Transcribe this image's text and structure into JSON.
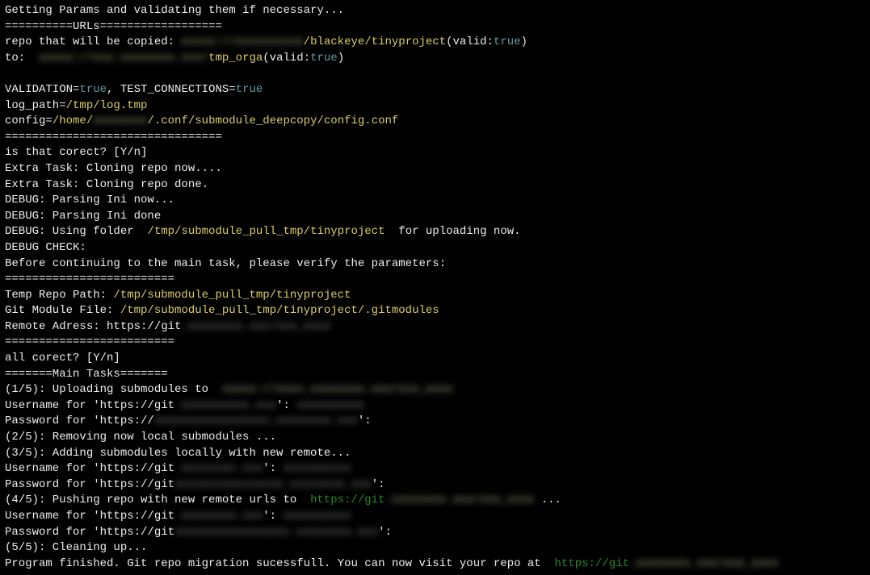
{
  "lines": [
    {
      "segments": [
        {
          "text": "Getting Params and validating them if necessary...",
          "cls": "c-white"
        }
      ]
    },
    {
      "segments": [
        {
          "text": "==========URLs==================",
          "cls": "c-white"
        }
      ]
    },
    {
      "segments": [
        {
          "text": "repo that will be copied: ",
          "cls": "c-white"
        },
        {
          "text": "xxxxx://xxxxxxxxxx",
          "cls": "blur"
        },
        {
          "text": "/blackeye/tinyproject",
          "cls": "c-yellow"
        },
        {
          "text": "(valid:",
          "cls": "c-white"
        },
        {
          "text": "true",
          "cls": "c-teal"
        },
        {
          "text": ")",
          "cls": "c-white"
        }
      ]
    },
    {
      "segments": [
        {
          "text": "to:  ",
          "cls": "c-white"
        },
        {
          "text": "xxxxx://xxx.xxxxxxxx.xxx/",
          "cls": "blur"
        },
        {
          "text": "tmp_orga",
          "cls": "c-yellow"
        },
        {
          "text": "(valid:",
          "cls": "c-white"
        },
        {
          "text": "true",
          "cls": "c-teal"
        },
        {
          "text": ")",
          "cls": "c-white"
        }
      ]
    },
    {
      "segments": [
        {
          "text": " ",
          "cls": "c-white"
        }
      ]
    },
    {
      "segments": [
        {
          "text": "VALIDATION=",
          "cls": "c-white"
        },
        {
          "text": "true",
          "cls": "c-teal"
        },
        {
          "text": ", TEST_CONNECTIONS=",
          "cls": "c-white"
        },
        {
          "text": "true",
          "cls": "c-teal"
        }
      ]
    },
    {
      "segments": [
        {
          "text": "log_path=",
          "cls": "c-white"
        },
        {
          "text": "/tmp/log.tmp",
          "cls": "c-yellow"
        }
      ]
    },
    {
      "segments": [
        {
          "text": "config=",
          "cls": "c-white"
        },
        {
          "text": "/home/",
          "cls": "c-yellow"
        },
        {
          "text": "xxxxxxxx",
          "cls": "blur"
        },
        {
          "text": "/.conf/submodule_deepcopy/config.conf",
          "cls": "c-yellow"
        }
      ]
    },
    {
      "segments": [
        {
          "text": "================================",
          "cls": "c-white"
        }
      ]
    },
    {
      "segments": [
        {
          "text": "is that corect? [Y/n]",
          "cls": "c-white"
        }
      ]
    },
    {
      "segments": [
        {
          "text": "Extra Task: Cloning repo now....",
          "cls": "c-white"
        }
      ]
    },
    {
      "segments": [
        {
          "text": "Extra Task: Cloning repo done.",
          "cls": "c-white"
        }
      ]
    },
    {
      "segments": [
        {
          "text": "DEBUG: Parsing Ini now...",
          "cls": "c-white"
        }
      ]
    },
    {
      "segments": [
        {
          "text": "DEBUG: Parsing Ini done",
          "cls": "c-white"
        }
      ]
    },
    {
      "segments": [
        {
          "text": "DEBUG: Using folder  ",
          "cls": "c-white"
        },
        {
          "text": "/tmp/submodule_pull_tmp/tinyproject",
          "cls": "c-yellow"
        },
        {
          "text": "  for uploading now.",
          "cls": "c-white"
        }
      ]
    },
    {
      "segments": [
        {
          "text": "DEBUG CHECK:",
          "cls": "c-white"
        }
      ]
    },
    {
      "segments": [
        {
          "text": "Before continuing to the main task, please verify the parameters:",
          "cls": "c-white"
        }
      ]
    },
    {
      "segments": [
        {
          "text": "=========================",
          "cls": "c-white"
        }
      ]
    },
    {
      "segments": [
        {
          "text": "Temp Repo Path: ",
          "cls": "c-white"
        },
        {
          "text": "/tmp/submodule_pull_tmp/tinyproject",
          "cls": "c-yellow"
        }
      ]
    },
    {
      "segments": [
        {
          "text": "Git Module File: ",
          "cls": "c-white"
        },
        {
          "text": "/tmp/submodule_pull_tmp/tinyproject/.gitmodules",
          "cls": "c-yellow"
        }
      ]
    },
    {
      "segments": [
        {
          "text": "Remote Adress: https://git",
          "cls": "c-white"
        },
        {
          "text": ".xxxxxxxx.xxx/xxx_xxxx",
          "cls": "blur-dim"
        }
      ]
    },
    {
      "segments": [
        {
          "text": "=========================",
          "cls": "c-white"
        }
      ]
    },
    {
      "segments": [
        {
          "text": "all corect? [Y/n]",
          "cls": "c-white"
        }
      ]
    },
    {
      "segments": [
        {
          "text": "=======Main Tasks=======",
          "cls": "c-white"
        }
      ]
    },
    {
      "segments": [
        {
          "text": "(1/5): Uploading submodules to  ",
          "cls": "c-white"
        },
        {
          "text": "xxxxx://xxxx.xxxxxxxx.xxx/xxx_xxxx",
          "cls": "blur"
        }
      ]
    },
    {
      "segments": [
        {
          "text": "Username for 'https://git",
          "cls": "c-white"
        },
        {
          "text": ".xxxxxxxxxx.xxx",
          "cls": "blur-dim"
        },
        {
          "text": "': ",
          "cls": "c-white"
        },
        {
          "text": "xxxxxxxxxx",
          "cls": "blur-dim"
        }
      ]
    },
    {
      "segments": [
        {
          "text": "Password for 'https://",
          "cls": "c-white"
        },
        {
          "text": "xxxxxxxxxxxxxxxxx.xxxxxxxx.xxx",
          "cls": "blur-dim"
        },
        {
          "text": "':",
          "cls": "c-white"
        }
      ]
    },
    {
      "segments": [
        {
          "text": "(2/5): Removing now local submodules ...",
          "cls": "c-white"
        }
      ]
    },
    {
      "segments": [
        {
          "text": "(3/5): Adding submodules locally with new remote...",
          "cls": "c-white"
        }
      ]
    },
    {
      "segments": [
        {
          "text": "Username for 'https://git",
          "cls": "c-white"
        },
        {
          "text": ".xxxxxxxx.xxx",
          "cls": "blur-dim"
        },
        {
          "text": "': ",
          "cls": "c-white"
        },
        {
          "text": "xxxxxxxxxx",
          "cls": "blur-dim"
        }
      ]
    },
    {
      "segments": [
        {
          "text": "Password for 'https://git",
          "cls": "c-white"
        },
        {
          "text": "xxxxxxxxxxxxxxxx.xxxxxxxx.xxx",
          "cls": "blur-dim"
        },
        {
          "text": "':",
          "cls": "c-white"
        }
      ]
    },
    {
      "segments": [
        {
          "text": "(4/5): Pushing repo with new remote urls to  ",
          "cls": "c-white"
        },
        {
          "text": "https://git",
          "cls": "c-green"
        },
        {
          "text": ".xxxxxxxx.xxx/xxx_xxxx",
          "cls": "blur"
        },
        {
          "text": " ...",
          "cls": "c-white"
        }
      ]
    },
    {
      "segments": [
        {
          "text": "Username for 'https://git",
          "cls": "c-white"
        },
        {
          "text": ".xxxxxxxx.xxx",
          "cls": "blur-dim"
        },
        {
          "text": "': ",
          "cls": "c-white"
        },
        {
          "text": "xxxxxxxxxx",
          "cls": "blur-dim"
        }
      ]
    },
    {
      "segments": [
        {
          "text": "Password for 'https://git",
          "cls": "c-white"
        },
        {
          "text": "xxxxxxxxxxxxxxxxx.xxxxxxxx.xxx",
          "cls": "blur-dim"
        },
        {
          "text": "':",
          "cls": "c-white"
        }
      ]
    },
    {
      "segments": [
        {
          "text": "(5/5): Cleaning up...",
          "cls": "c-white"
        }
      ]
    },
    {
      "segments": [
        {
          "text": "Program finished. Git repo migration sucessfull. You can now visit your repo at  ",
          "cls": "c-white"
        },
        {
          "text": "https://git",
          "cls": "c-green"
        },
        {
          "text": ".xxxxxxxx.xxx/xxx_xxxx",
          "cls": "blur"
        }
      ]
    }
  ]
}
